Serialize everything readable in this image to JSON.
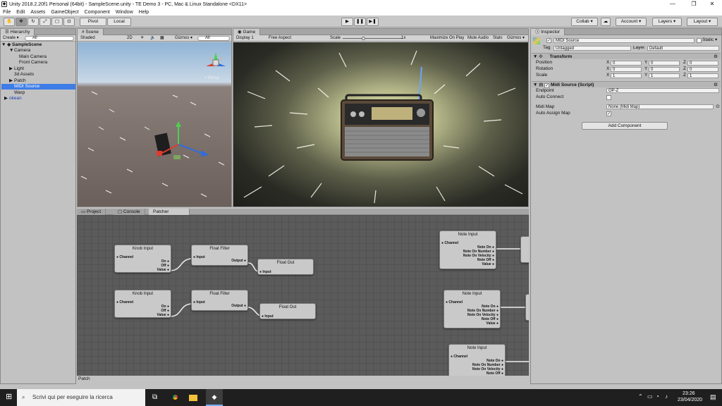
{
  "window": {
    "title": "Unity 2018.2.20f1 Personal (64bit) - SampleScene.unity - TE Demo 3 - PC, Mac & Linux Standalone <DX11>",
    "minimize": "—",
    "maximize": "❐",
    "close": "✕"
  },
  "menu": [
    "File",
    "Edit",
    "Assets",
    "GameObject",
    "Component",
    "Window",
    "Help"
  ],
  "toolbar": {
    "pivot": "Pivot",
    "local": "Local",
    "collab": "Collab ▾",
    "account": "Account ▾",
    "layers": "Layers ▾",
    "layout": "Layout ▾"
  },
  "hierarchy": {
    "tab": "Hierarchy",
    "create": "Create ▾",
    "search": "All",
    "scene": "SampleScene",
    "items": [
      {
        "label": "Camera",
        "indent": 1,
        "arrow": "▼"
      },
      {
        "label": "Main Camera",
        "indent": 2,
        "arrow": ""
      },
      {
        "label": "Front Camera",
        "indent": 2,
        "arrow": ""
      },
      {
        "label": "Light",
        "indent": 1,
        "arrow": "▶"
      },
      {
        "label": "3d Assets",
        "indent": 1,
        "arrow": ""
      },
      {
        "label": "Patch",
        "indent": 1,
        "arrow": "▶"
      },
      {
        "label": "MIDI Source",
        "indent": 1,
        "arrow": "",
        "selected": true
      },
      {
        "label": "Warp",
        "indent": 1,
        "arrow": ""
      },
      {
        "label": "okean",
        "indent": 0,
        "arrow": "▶",
        "blue": true
      }
    ]
  },
  "scene": {
    "tab": "Scene",
    "shading": "Shaded",
    "mode2d": "2D",
    "gizmos": "Gizmos ▾",
    "search": "All",
    "persp": "< Persp"
  },
  "game": {
    "tab": "Game",
    "display": "Display 1",
    "aspect": "Free Aspect",
    "scale_label": "Scale",
    "scale_value": "1x",
    "maximize_on_play": "Maximize On Play",
    "mute_audio": "Mute Audio",
    "stats": "Stats",
    "gizmos": "Gizmos ▾"
  },
  "bottom_tabs": [
    "Project",
    "Console",
    "Patcher"
  ],
  "patch_footer": "Patch",
  "nodes": {
    "knob1": {
      "title": "Knob Input",
      "in": [
        "Channel"
      ],
      "out": [
        "On",
        "Off",
        "Value"
      ]
    },
    "knob2": {
      "title": "Knob Input",
      "in": [
        "Channel"
      ],
      "out": [
        "On",
        "Off",
        "Value"
      ]
    },
    "filter1": {
      "title": "Float Filter",
      "in": [
        "Input"
      ],
      "out": [
        "Output"
      ]
    },
    "filter2": {
      "title": "Float Filter",
      "in": [
        "Input"
      ],
      "out": [
        "Output"
      ]
    },
    "out1": {
      "title": "Float Out",
      "in": [
        "Input"
      ]
    },
    "out2": {
      "title": "Float Out",
      "in": [
        "Input"
      ]
    },
    "note1": {
      "title": "Note Input",
      "in": [
        "Channel"
      ],
      "out": [
        "Note On",
        "Note On Number",
        "Note On Velocity",
        "Note Off",
        "Value"
      ]
    },
    "note2": {
      "title": "Note Input",
      "in": [
        "Channel"
      ],
      "out": [
        "Note On",
        "Note On Number",
        "Note On Velocity",
        "Note Off",
        "Value"
      ]
    },
    "note3": {
      "title": "Note Input",
      "in": [
        "Channel"
      ],
      "out": [
        "Note On",
        "Note On Number",
        "Note On Velocity",
        "Note Off"
      ]
    }
  },
  "inspector": {
    "tab": "Inspector",
    "object_name": "MIDI Source",
    "static_label": "Static ▾",
    "tag_label": "Tag",
    "tag_value": "Untagged",
    "layer_label": "Layer",
    "layer_value": "Default",
    "transform": {
      "header": "Transform",
      "rows": [
        {
          "label": "Position",
          "x": "0",
          "y": "0",
          "z": "0"
        },
        {
          "label": "Rotation",
          "x": "0",
          "y": "0",
          "z": "0"
        },
        {
          "label": "Scale",
          "x": "1",
          "y": "1",
          "z": "1"
        }
      ]
    },
    "midi": {
      "header": "Midi Source (Script)",
      "endpoint_label": "Endpoint",
      "endpoint_value": "OP-Z",
      "auto_connect_label": "Auto Connect",
      "midi_map_label": "Midi Map",
      "midi_map_value": "None (Midi Map)",
      "auto_assign_label": "Auto Assign Map"
    },
    "add_component": "Add Component"
  },
  "taskbar": {
    "search_placeholder": "Scrivi qui per eseguire la ricerca",
    "time": "23:26",
    "date": "23/04/2020"
  },
  "colors": {
    "selection": "#3e7de8",
    "patcher_bg": "#5b5b5b",
    "taskbar": "#1f1f1f"
  }
}
